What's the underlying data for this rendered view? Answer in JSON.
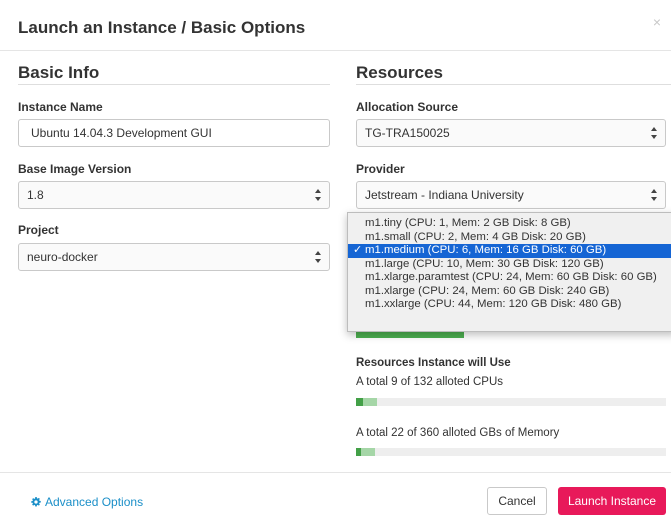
{
  "modal": {
    "title": "Launch an Instance / Basic Options",
    "close": "×"
  },
  "basic_info": {
    "heading": "Basic Info",
    "instance_name_label": "Instance Name",
    "instance_name_value": "Ubuntu 14.04.3 Development GUI",
    "base_image_label": "Base Image Version",
    "base_image_value": "1.8",
    "project_label": "Project",
    "project_value": "neuro-docker"
  },
  "resources": {
    "heading": "Resources",
    "allocation_label": "Allocation Source",
    "allocation_value": "TG-TRA150025",
    "provider_label": "Provider",
    "provider_value": "Jetstream - Indiana University"
  },
  "size_dropdown": {
    "options": [
      "m1.tiny (CPU: 1, Mem: 2 GB Disk: 8 GB)",
      "m1.small (CPU: 2, Mem: 4 GB Disk: 20 GB)",
      "m1.medium (CPU: 6, Mem: 16 GB Disk: 60 GB)",
      "m1.large (CPU: 10, Mem: 30 GB Disk: 120 GB)",
      "m1.xlarge.paramtest (CPU: 24, Mem: 60 GB Disk: 60 GB)",
      "m1.xlarge (CPU: 24, Mem: 60 GB Disk: 240 GB)",
      "m1.xxlarge (CPU: 44, Mem: 120 GB Disk: 480 GB)"
    ],
    "selected_index": 2,
    "check": "✓"
  },
  "usage": {
    "title": "Resources Instance will Use",
    "cpu_text": "A total 9 of 132 alloted CPUs",
    "cpu_used_fraction": 0.023,
    "cpu_new_fraction": 0.045,
    "memory_text": "A total 22 of 360 alloted GBs of Memory",
    "memory_used_fraction": 0.017,
    "memory_new_fraction": 0.044,
    "colors": {
      "used": "#43a047",
      "new": "#a5d6a7"
    }
  },
  "footer": {
    "advanced_label": "Advanced Options",
    "cancel_label": "Cancel",
    "launch_label": "Launch Instance",
    "launch_color": "#e8195a",
    "link_color": "#1b8fc8"
  }
}
